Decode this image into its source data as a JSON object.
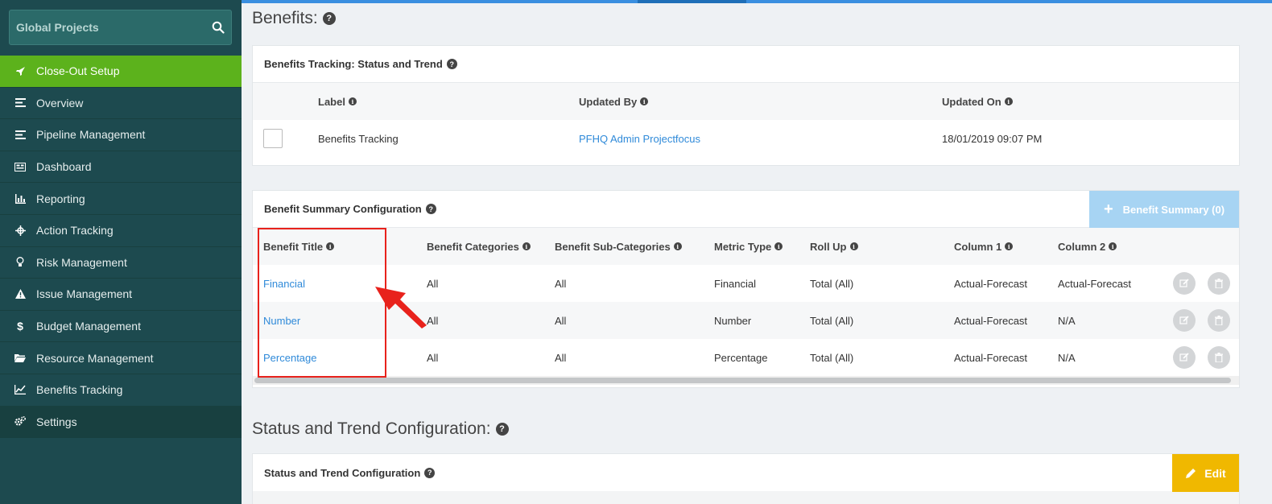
{
  "sidebar": {
    "search_label": "Global Projects",
    "items": [
      {
        "label": "Close-Out Setup",
        "icon": "rocket-icon"
      },
      {
        "label": "Overview",
        "icon": "list-icon"
      },
      {
        "label": "Pipeline Management",
        "icon": "list-icon"
      },
      {
        "label": "Dashboard",
        "icon": "dashboard-icon"
      },
      {
        "label": "Reporting",
        "icon": "bar-chart-icon"
      },
      {
        "label": "Action Tracking",
        "icon": "crosshair-icon"
      },
      {
        "label": "Risk Management",
        "icon": "lightbulb-icon"
      },
      {
        "label": "Issue Management",
        "icon": "warning-icon"
      },
      {
        "label": "Budget Management",
        "icon": "dollar-icon"
      },
      {
        "label": "Resource Management",
        "icon": "folder-icon"
      },
      {
        "label": "Benefits Tracking",
        "icon": "line-chart-icon"
      },
      {
        "label": "Settings",
        "icon": "gears-icon"
      }
    ]
  },
  "benefits": {
    "title": "Benefits:",
    "tracking_panel": {
      "title": "Benefits Tracking: Status and Trend",
      "columns": [
        "Label",
        "Updated By",
        "Updated On"
      ],
      "row": {
        "label": "Benefits Tracking",
        "updated_by": "PFHQ Admin Projectfocus",
        "updated_on": "18/01/2019 09:07 PM"
      }
    },
    "summary_panel": {
      "title": "Benefit Summary Configuration",
      "add_button": "Benefit Summary (0)",
      "columns": [
        "Benefit Title",
        "Benefit Categories",
        "Benefit Sub-Categories",
        "Metric Type",
        "Roll Up",
        "Column 1",
        "Column 2"
      ],
      "rows": [
        [
          "Financial",
          "All",
          "All",
          "Financial",
          "Total (All)",
          "Actual-Forecast",
          "Actual-Forecast"
        ],
        [
          "Number",
          "All",
          "All",
          "Number",
          "Total (All)",
          "Actual-Forecast",
          "N/A"
        ],
        [
          "Percentage",
          "All",
          "All",
          "Percentage",
          "Total (All)",
          "Actual-Forecast",
          "N/A"
        ]
      ]
    }
  },
  "status_trend": {
    "title": "Status and Trend Configuration:",
    "panel_title": "Status and Trend Configuration",
    "edit_button": "Edit"
  },
  "colors": {
    "active_nav": "#5cb21c",
    "link": "#2f8ad9",
    "edit": "#f0b800",
    "annotation": "#e8221c"
  }
}
